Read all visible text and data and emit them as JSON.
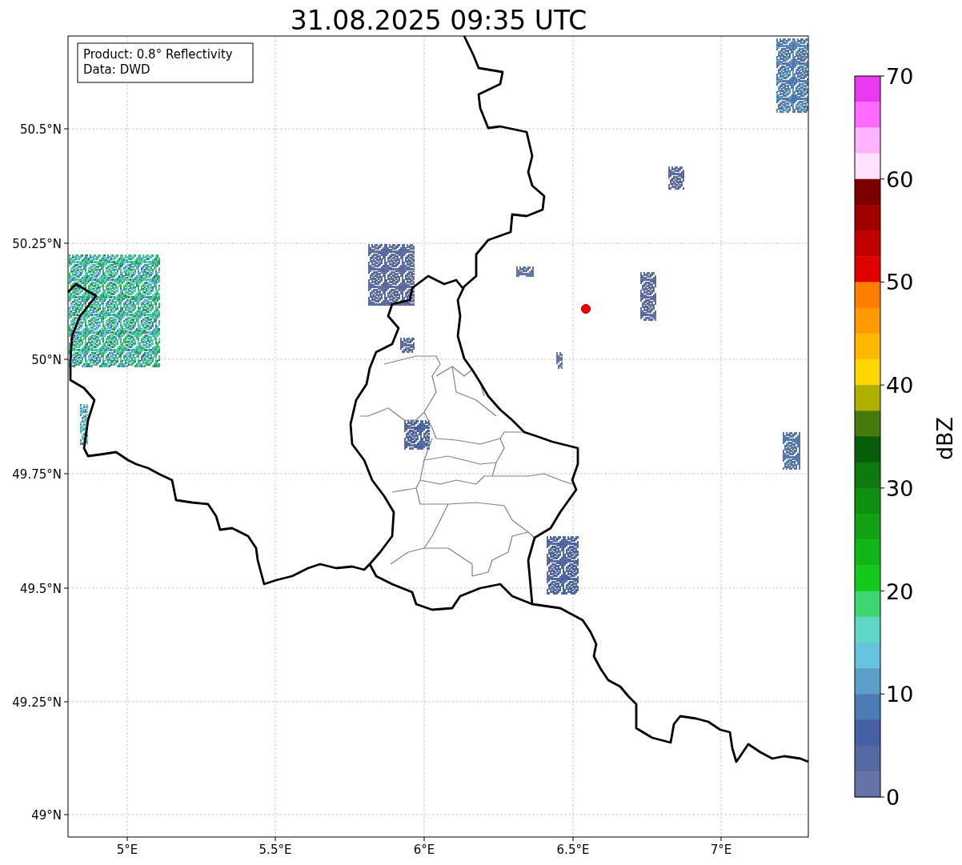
{
  "title": "31.08.2025 09:35 UTC",
  "info_box": [
    "Product: 0.8° Reflectivity",
    "Data: DWD"
  ],
  "map": {
    "yticks": [
      "50.5°N",
      "50.25°N",
      "50°N",
      "49.75°N",
      "49.5°N",
      "49.25°N",
      "49°N"
    ],
    "xticks": [
      "5°E",
      "5.5°E",
      "6°E",
      "6.5°E",
      "7°E"
    ]
  },
  "colorbar": {
    "label": "dBZ",
    "ticks": [
      "70",
      "60",
      "50",
      "40",
      "30",
      "20",
      "10",
      "0"
    ],
    "segments": [
      {
        "color": "#e838f0"
      },
      {
        "color": "#ff6bff"
      },
      {
        "color": "#ffb3ff"
      },
      {
        "color": "#ffe0ff"
      },
      {
        "color": "#7c0000"
      },
      {
        "color": "#a00000"
      },
      {
        "color": "#c00000"
      },
      {
        "color": "#e00000"
      },
      {
        "color": "#ff7d00"
      },
      {
        "color": "#ff9a00"
      },
      {
        "color": "#ffb800"
      },
      {
        "color": "#ffd700"
      },
      {
        "color": "#b0b000"
      },
      {
        "color": "#477a0c"
      },
      {
        "color": "#065e0a"
      },
      {
        "color": "#0c7a0e"
      },
      {
        "color": "#0e8f10"
      },
      {
        "color": "#10a213"
      },
      {
        "color": "#10b516"
      },
      {
        "color": "#12c91c"
      },
      {
        "color": "#3dd671"
      },
      {
        "color": "#5fd7c6"
      },
      {
        "color": "#66c2dd"
      },
      {
        "color": "#5b9ec8"
      },
      {
        "color": "#4a7bb3"
      },
      {
        "color": "#4560a5"
      },
      {
        "color": "#5568a0"
      },
      {
        "color": "#6474a9"
      }
    ]
  }
}
